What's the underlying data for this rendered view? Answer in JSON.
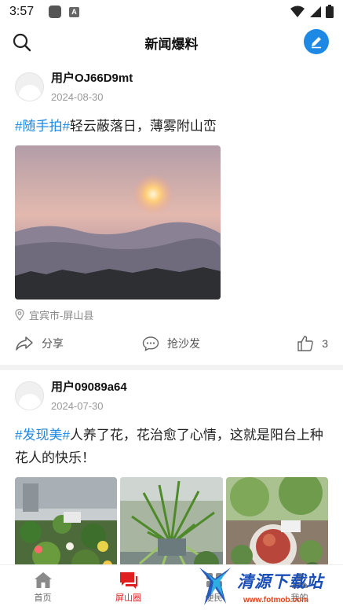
{
  "status_bar": {
    "time": "3:57",
    "a_icon_label": "A"
  },
  "header": {
    "title": "新闻爆料"
  },
  "posts": [
    {
      "user": "用户OJ66D9mt",
      "date": "2024-08-30",
      "tag": "#随手拍#",
      "text": "轻云蔽落日，薄雾附山峦",
      "location": "宜宾市-屏山县",
      "share_label": "分享",
      "comment_label": "抢沙发",
      "like_count": "3"
    },
    {
      "user": "用户09089a64",
      "date": "2024-07-30",
      "tag": "#发现美#",
      "text": "人养了花，花治愈了心情，这就是阳台上种花人的快乐！"
    }
  ],
  "bottom_nav": [
    {
      "label": "首页",
      "icon": "home-icon"
    },
    {
      "label": "屏山圈",
      "icon": "chat-icon",
      "active": true
    },
    {
      "label": "便民",
      "icon": "service-icon"
    },
    {
      "label": "我的",
      "icon": "user-icon"
    }
  ],
  "watermark": {
    "title": "清源下载站",
    "url": "www.fotmob.com"
  },
  "colors": {
    "accent": "#1e88e5",
    "active_nav": "#e02020"
  }
}
